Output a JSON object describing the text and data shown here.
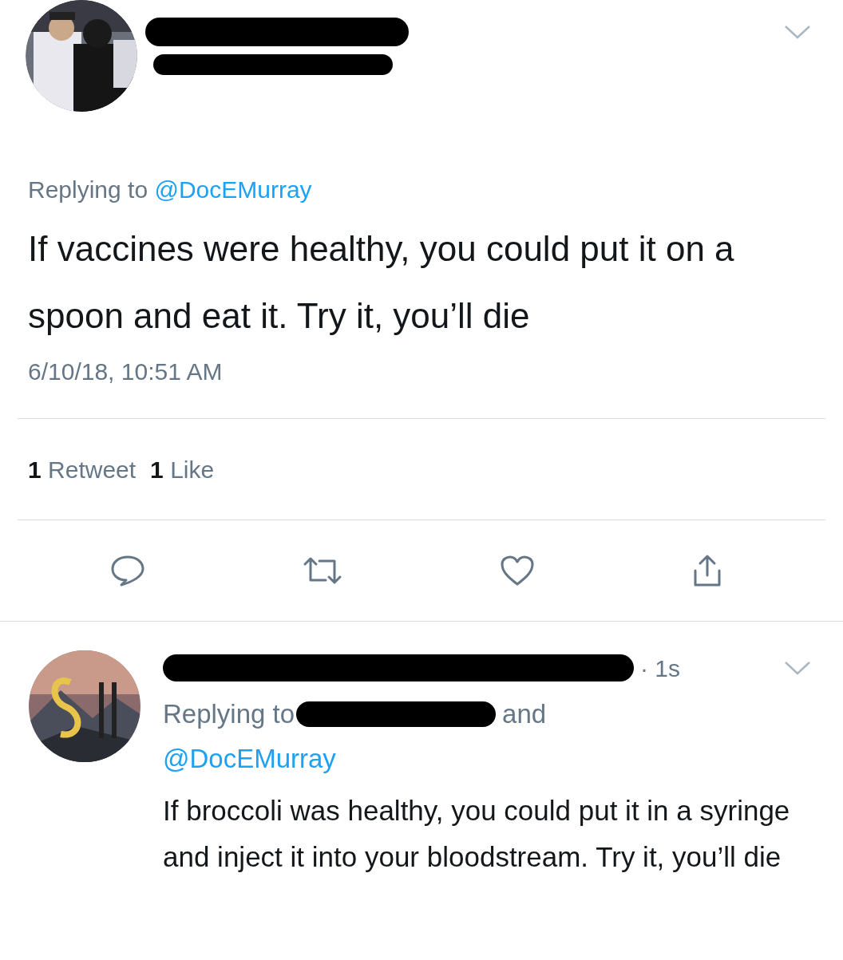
{
  "tweet": {
    "replying_to_label": "Replying to",
    "replying_to_handle": "@DocEMurray",
    "text": "If vaccines were healthy, you could put it on a spoon and eat it. Try it, you’ll die",
    "timestamp": "6/10/18, 10:51 AM",
    "stats": [
      {
        "count": "1",
        "label": "Retweet"
      },
      {
        "count": "1",
        "label": "Like"
      }
    ]
  },
  "reply": {
    "time": "· 1s",
    "replying_to_label": "Replying to",
    "conjunction": "and",
    "handle": "@DocEMurray",
    "text": "If broccoli was healthy, you could put it in a syringe and inject it into your bloodstream. Try it, you’ll die"
  }
}
